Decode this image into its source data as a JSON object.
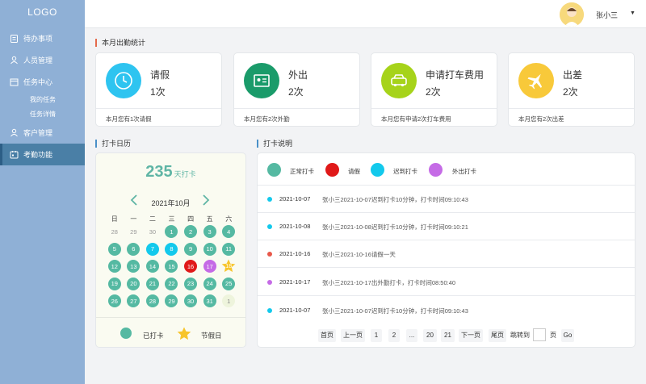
{
  "sidebar": {
    "logo": "LOGO",
    "items": [
      {
        "label": "待办事项",
        "icon": "clipboard-icon"
      },
      {
        "label": "人员管理",
        "icon": "users-icon"
      },
      {
        "label": "任务中心",
        "icon": "task-icon"
      },
      {
        "label": "客户管理",
        "icon": "customer-icon"
      },
      {
        "label": "考勤功能",
        "icon": "calendar-icon"
      }
    ],
    "subitems": [
      {
        "label": "我的任务"
      },
      {
        "label": "任务详情"
      }
    ]
  },
  "header": {
    "username": "张小三",
    "caret": "▼",
    "avatar_icon": "user-avatar-icon"
  },
  "stats": {
    "title": "本月出勤统计",
    "cards": [
      {
        "title": "请假",
        "count": "1次",
        "footer": "本月您有1次请假",
        "color": "#2ec4f0",
        "icon": "clock-person-icon"
      },
      {
        "title": "外出",
        "count": "2次",
        "footer": "本月您有2次外勤",
        "color": "#1a9b6a",
        "icon": "id-card-icon"
      },
      {
        "title": "申请打车费用",
        "count": "2次",
        "footer": "本月您有申请2次打车费用",
        "color": "#a6d31a",
        "icon": "taxi-icon"
      },
      {
        "title": "出差",
        "count": "2次",
        "footer": "本月您有2次出差",
        "color": "#f8c93a",
        "icon": "airplane-icon"
      }
    ]
  },
  "calendar": {
    "title": "打卡日历",
    "count": "235",
    "count_unit": "天打卡",
    "month": "2021年10月",
    "prev_icon": "chevron-left-icon",
    "next_icon": "chevron-right-icon",
    "weekdays": [
      "日",
      "一",
      "二",
      "三",
      "四",
      "五",
      "六"
    ],
    "days": [
      {
        "d": "28",
        "s": "other"
      },
      {
        "d": "29",
        "s": "other"
      },
      {
        "d": "30",
        "s": "other"
      },
      {
        "d": "1",
        "s": "punch"
      },
      {
        "d": "2",
        "s": "punch"
      },
      {
        "d": "3",
        "s": "punch"
      },
      {
        "d": "4",
        "s": "punch"
      },
      {
        "d": "5",
        "s": "punch"
      },
      {
        "d": "6",
        "s": "punch"
      },
      {
        "d": "7",
        "s": "late"
      },
      {
        "d": "8",
        "s": "late"
      },
      {
        "d": "9",
        "s": "punch"
      },
      {
        "d": "10",
        "s": "punch"
      },
      {
        "d": "11",
        "s": "punch"
      },
      {
        "d": "12",
        "s": "punch"
      },
      {
        "d": "13",
        "s": "punch"
      },
      {
        "d": "14",
        "s": "punch"
      },
      {
        "d": "15",
        "s": "punch"
      },
      {
        "d": "16",
        "s": "leave"
      },
      {
        "d": "17",
        "s": "out"
      },
      {
        "d": "18",
        "s": "holiday"
      },
      {
        "d": "19",
        "s": "punch"
      },
      {
        "d": "20",
        "s": "punch"
      },
      {
        "d": "21",
        "s": "punch"
      },
      {
        "d": "22",
        "s": "punch"
      },
      {
        "d": "23",
        "s": "punch"
      },
      {
        "d": "24",
        "s": "punch"
      },
      {
        "d": "25",
        "s": "punch"
      },
      {
        "d": "26",
        "s": "punch"
      },
      {
        "d": "27",
        "s": "punch"
      },
      {
        "d": "28",
        "s": "punch"
      },
      {
        "d": "29",
        "s": "punch"
      },
      {
        "d": "30",
        "s": "punch"
      },
      {
        "d": "31",
        "s": "punch"
      },
      {
        "d": "1",
        "s": "plain"
      }
    ],
    "legend": {
      "punched": "已打卡",
      "holiday": "节假日",
      "star_icon": "star-icon"
    }
  },
  "info": {
    "title": "打卡说明",
    "legend": [
      {
        "label": "正常打卡",
        "color": "#55b9a2"
      },
      {
        "label": "请假",
        "color": "#e01919"
      },
      {
        "label": "迟到打卡",
        "color": "#13c9ec"
      },
      {
        "label": "外出打卡",
        "color": "#c56be6"
      }
    ],
    "records": [
      {
        "date": "2021-10-07",
        "text": "张小三2021-10-07迟到打卡10分钟，打卡时间09:10:43",
        "color": "#13c9ec"
      },
      {
        "date": "2021-10-08",
        "text": "张小三2021-10-08迟到打卡10分钟，打卡时间09:10:21",
        "color": "#13c9ec"
      },
      {
        "date": "2021-10-16",
        "text": "张小三2021-10-16请假一天",
        "color": "#e8584a"
      },
      {
        "date": "2021-10-17",
        "text": "张小三2021-10-17出外勤打卡，打卡时间08:50:40",
        "color": "#c56be6"
      },
      {
        "date": "2021-10-07",
        "text": "张小三2021-10-07迟到打卡10分钟，打卡时间09:10:43",
        "color": "#13c9ec"
      }
    ],
    "pager": {
      "first": "首页",
      "prev": "上一页",
      "p1": "1",
      "p2": "2",
      "ellipsis": "...",
      "p20": "20",
      "p21": "21",
      "next": "下一页",
      "last": "尾页",
      "goto": "跳转到",
      "page_unit": "页",
      "go": "Go"
    }
  }
}
